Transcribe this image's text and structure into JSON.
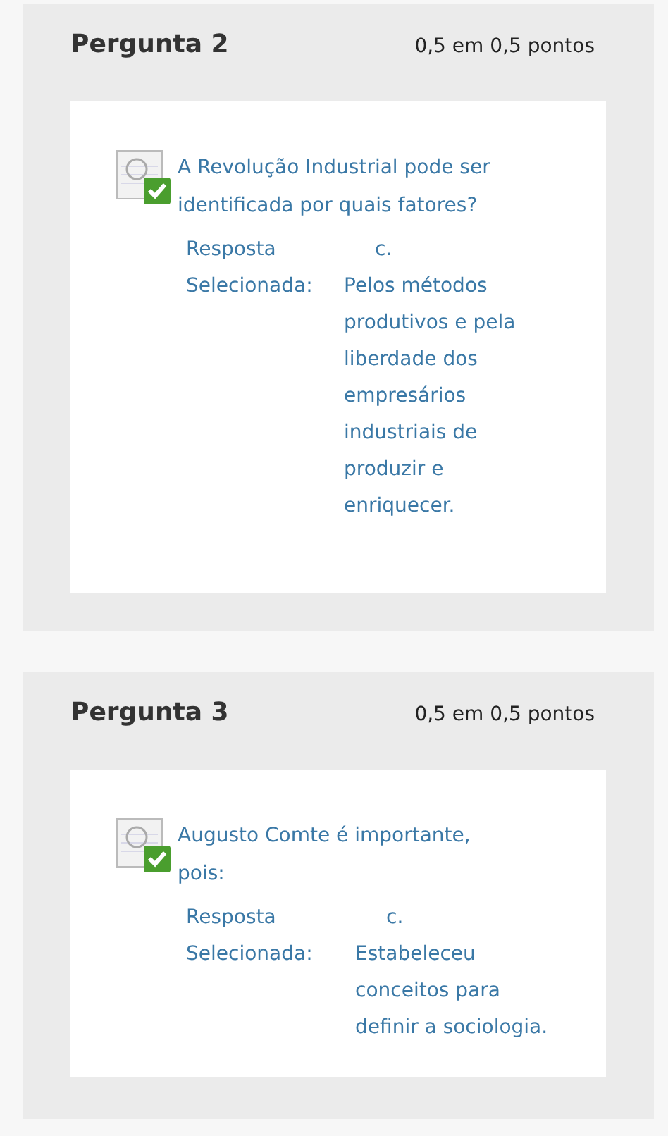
{
  "questions": [
    {
      "title": "Pergunta 2",
      "score": "0,5 em 0,5 pontos",
      "correct": true,
      "text": "A Revolução Industrial pode ser identificada por quais fatores?",
      "answer_label": "Resposta Selecionada:",
      "answer_letter": "c.",
      "answer_text": "Pelos métodos produtivos e pela liberdade dos empresários industriais de produzir e enriquecer."
    },
    {
      "title": "Pergunta 3",
      "score": "0,5 em 0,5 pontos",
      "correct": true,
      "text": "Augusto Comte é importante, pois:",
      "answer_label": "Resposta Selecionada:",
      "answer_letter": "c.",
      "answer_text": "Estabeleceu conceitos para definir a sociologia."
    }
  ]
}
